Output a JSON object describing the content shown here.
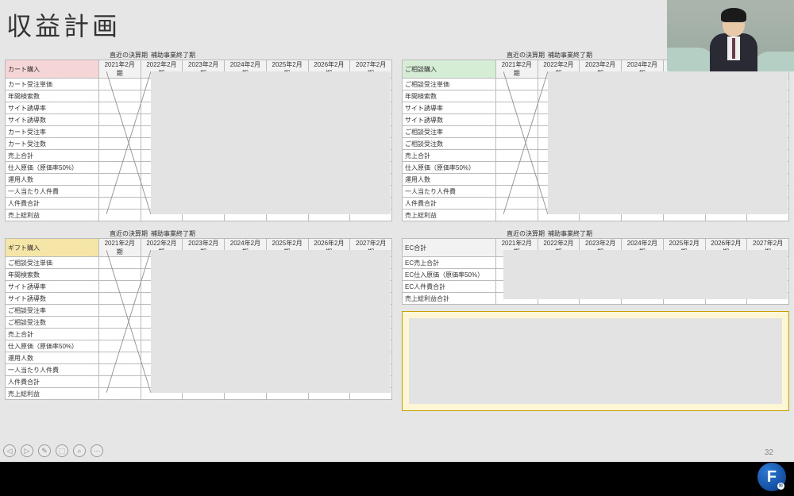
{
  "title": "収益計画",
  "sublabels": {
    "recent": "直近の決算期",
    "end": "補助事業終了期"
  },
  "years": [
    "2021年2月期",
    "2022年2月期",
    "2023年2月期",
    "2024年2月期",
    "2025年2月期",
    "2026年2月期",
    "2027年2月期"
  ],
  "tables": {
    "cart": {
      "header": "カート購入",
      "header_class": "hdr-pink",
      "rows": [
        "カート受注単価",
        "年間検索数",
        "サイト誘導率",
        "サイト誘導数",
        "カート受注率",
        "カート受注数",
        "売上合計",
        "仕入原価（原価率50%）",
        "運用人数",
        "一人当たり人件費",
        "人件費合計",
        "売上総利益"
      ]
    },
    "gift": {
      "header": "ギフト購入",
      "header_class": "hdr-yellow",
      "rows": [
        "ご相談受注単価",
        "年間検索数",
        "サイト誘導率",
        "サイト誘導数",
        "ご相談受注率",
        "ご相談受注数",
        "売上合計",
        "仕入原価（原価率50%）",
        "運用人数",
        "一人当たり人件費",
        "人件費合計",
        "売上総利益"
      ]
    },
    "consult": {
      "header": "ご相談購入",
      "header_class": "hdr-green",
      "rows": [
        "ご相談受注単価",
        "年間検索数",
        "サイト誘導率",
        "サイト誘導数",
        "ご相談受注率",
        "ご相談受注数",
        "売上合計",
        "仕入原価（原価率50%）",
        "運用人数",
        "一人当たり人件費",
        "人件費合計",
        "売上総利益"
      ]
    },
    "ec": {
      "header": "EC合計",
      "header_class": "hdr-plain",
      "rows": [
        "EC売上合計",
        "EC仕入原価（原価率50%）",
        "EC人件費合計",
        "売上総利益合計"
      ]
    }
  },
  "pagenum": "32",
  "logo": "F"
}
